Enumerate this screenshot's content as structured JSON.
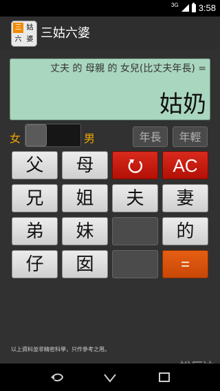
{
  "status": {
    "network": "3G",
    "time": "3:58"
  },
  "app": {
    "title": "三姑六婆",
    "icon_chars": [
      "三",
      "姑",
      "六",
      "婆"
    ],
    "icon_accent": "#f08a00"
  },
  "display": {
    "expression": "丈夫 的 母親 的 女兒(比丈夫年長) =",
    "result": "姑奶",
    "background": "#a9d6be"
  },
  "gender": {
    "female_label": "女",
    "male_label": "男",
    "accent": "#f0a600"
  },
  "age_buttons": {
    "older": "年長",
    "younger": "年輕"
  },
  "keypad": {
    "father": "父",
    "mother": "母",
    "reset": "↺",
    "ac": "AC",
    "brother_older": "兄",
    "sister_older": "姐",
    "husband": "夫",
    "wife": "妻",
    "brother_younger": "弟",
    "sister_younger": "妹",
    "of": "的",
    "son": "仔",
    "daughter": "囡",
    "equals": "="
  },
  "footer": {
    "note": "以上資料並非精密科學，只作參考之用。",
    "watermark": "裕辰达"
  },
  "navigation": {
    "back_icon": "back-icon",
    "home_icon": "home-icon",
    "recent_icon": "recent-apps-icon"
  }
}
